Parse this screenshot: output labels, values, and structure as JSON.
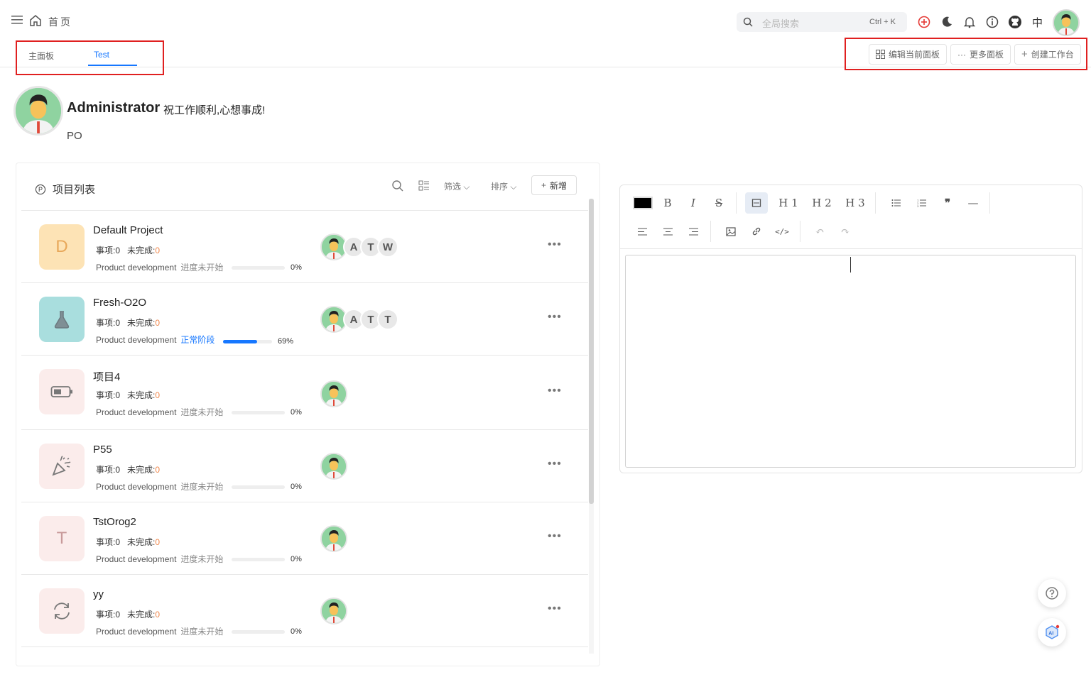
{
  "header": {
    "breadcrumb": "首页",
    "search_placeholder": "全局搜索",
    "search_shortcut": "Ctrl + K",
    "lang": "中"
  },
  "tabs": [
    {
      "label": "主面板",
      "active": false
    },
    {
      "label": "Test",
      "active": true
    }
  ],
  "actions": {
    "edit_board": "编辑当前面板",
    "more_boards": "更多面板",
    "create_workspace": "创建工作台"
  },
  "profile": {
    "name": "Administrator",
    "greeting": "祝工作顺利,心想事成!",
    "role": "PO"
  },
  "projects_panel": {
    "icon_letter": "P",
    "title": "项目列表",
    "filter_label": "筛选",
    "sort_label": "排序",
    "new_label": "新增",
    "items_label": "事项:",
    "unfinished_label": "未完成:",
    "projects": [
      {
        "name": "Default Project",
        "icon": "D",
        "icon_bg": "#fde3b5",
        "icon_color": "#e8a85a",
        "items": "0",
        "unfinished": "0",
        "category": "Product development",
        "stage": "进度未开始",
        "progress": 0,
        "progress_label": "0%",
        "members": [
          "A",
          "T",
          "W"
        ]
      },
      {
        "name": "Fresh-O2O",
        "icon": "flask-icon",
        "icon_bg": "#a9dede",
        "icon_color": "#6c7a80",
        "items": "0",
        "unfinished": "0",
        "category": "Product development",
        "stage": "正常阶段",
        "progress": 0.69,
        "progress_label": "69%",
        "members": [
          "A",
          "T",
          "T"
        ]
      },
      {
        "name": "项目4",
        "icon": "battery-icon",
        "icon_bg": "#fbeceb",
        "icon_color": "#777",
        "items": "0",
        "unfinished": "0",
        "category": "Product development",
        "stage": "进度未开始",
        "progress": 0,
        "progress_label": "0%",
        "members": []
      },
      {
        "name": "P55",
        "icon": "party-popper-icon",
        "icon_bg": "#fbeceb",
        "icon_color": "#777",
        "items": "0",
        "unfinished": "0",
        "category": "Product development",
        "stage": "进度未开始",
        "progress": 0,
        "progress_label": "0%",
        "members": []
      },
      {
        "name": "TstOrog2",
        "icon": "T",
        "icon_bg": "#fbeceb",
        "icon_color": "#c89a9a",
        "items": "0",
        "unfinished": "0",
        "category": "Product development",
        "stage": "进度未开始",
        "progress": 0,
        "progress_label": "0%",
        "members": []
      },
      {
        "name": "yy",
        "icon": "refresh-icon",
        "icon_bg": "#fbeceb",
        "icon_color": "#777",
        "items": "0",
        "unfinished": "0",
        "category": "Product development",
        "stage": "进度未开始",
        "progress": 0,
        "progress_label": "0%",
        "members": []
      }
    ]
  },
  "editor": {
    "toolbar": [
      "text-color",
      "bold",
      "italic",
      "strikethrough",
      "code-block",
      "H 1",
      "H 2",
      "H 3",
      "bullet-list",
      "ordered-list",
      "quote",
      "horizontal-rule",
      "align-left",
      "align-center",
      "align-right",
      "image",
      "link",
      "code",
      "undo",
      "redo"
    ],
    "content": ""
  },
  "colors": {
    "accent": "#1677ff",
    "highlight_box": "#e02020",
    "unfinished": "#f0864a"
  }
}
